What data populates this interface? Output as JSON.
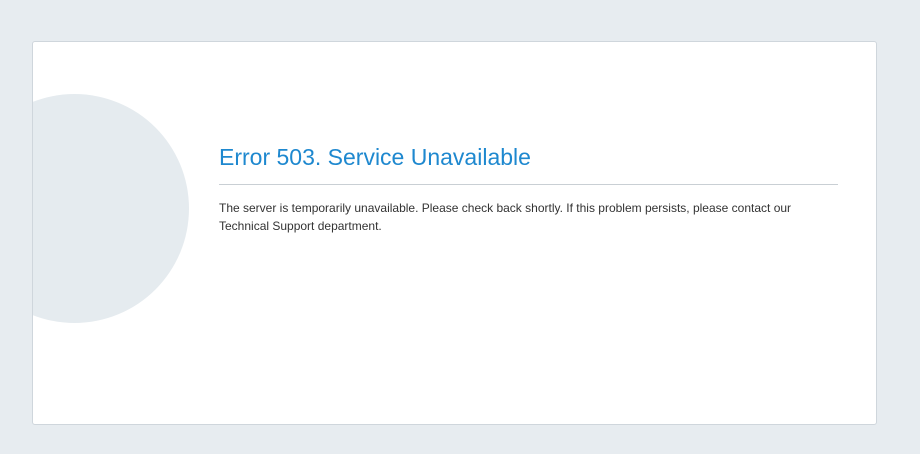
{
  "error": {
    "title": "Error 503. Service Unavailable",
    "message": "The server is temporarily unavailable. Please check back shortly. If this problem persists, please contact our Technical Support department."
  },
  "icon": "exclamation-icon",
  "colors": {
    "background": "#e7ecf0",
    "card": "#ffffff",
    "accent": "#1e88cf",
    "icon_circle": "#e5ebef",
    "text": "#333333"
  }
}
